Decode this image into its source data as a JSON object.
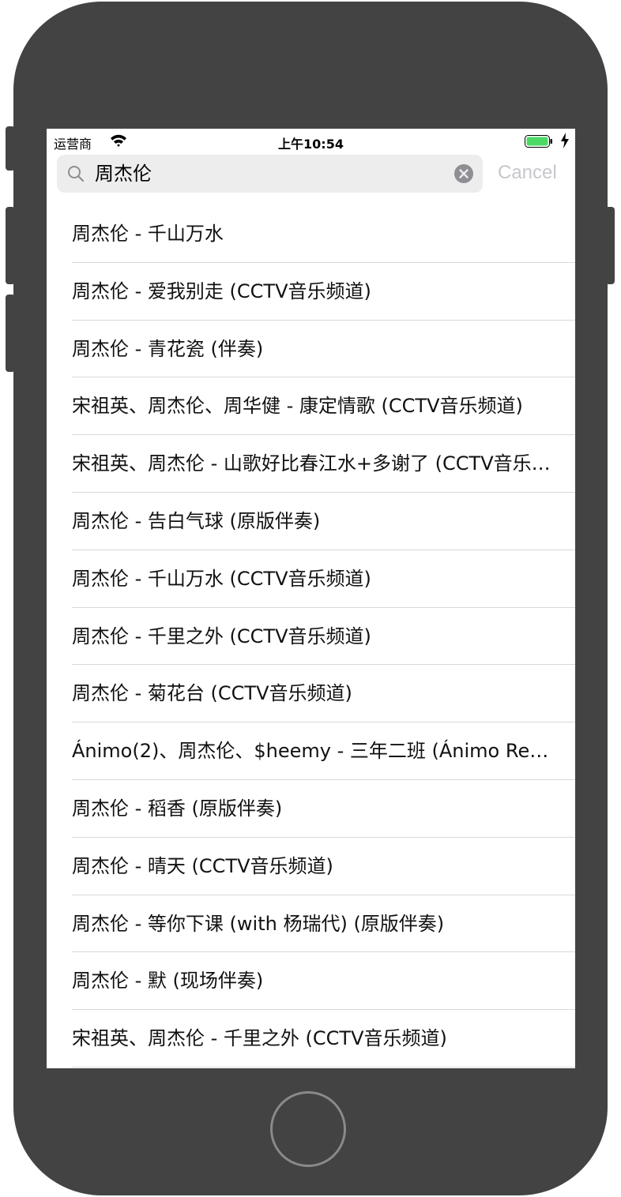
{
  "status_bar": {
    "carrier": "运营商",
    "time": "上午10:54",
    "battery_color": "#4cd964"
  },
  "search": {
    "query": "周杰伦",
    "cancel_label": "Cancel"
  },
  "results": [
    "周杰伦 - 千山万水",
    "周杰伦 - 爱我别走 (CCTV音乐频道)",
    "周杰伦 - 青花瓷 (伴奏)",
    "宋祖英、周杰伦、周华健 - 康定情歌 (CCTV音乐频道)",
    "宋祖英、周杰伦 - 山歌好比春江水+多谢了 (CCTV音乐频道)",
    "周杰伦 - 告白气球 (原版伴奏)",
    "周杰伦 - 千山万水 (CCTV音乐频道)",
    "周杰伦 - 千里之外 (CCTV音乐频道)",
    "周杰伦 - 菊花台 (CCTV音乐频道)",
    "Ánimo(2)、周杰伦、$heemy - 三年二班 (Ánimo Remix)",
    "周杰伦 - 稻香 (原版伴奏)",
    "周杰伦 - 晴天 (CCTV音乐频道)",
    "周杰伦 - 等你下课 (with 杨瑞代) (原版伴奏)",
    "周杰伦 - 默 (现场伴奏)",
    "宋祖英、周杰伦 - 千里之外 (CCTV音乐频道)"
  ]
}
